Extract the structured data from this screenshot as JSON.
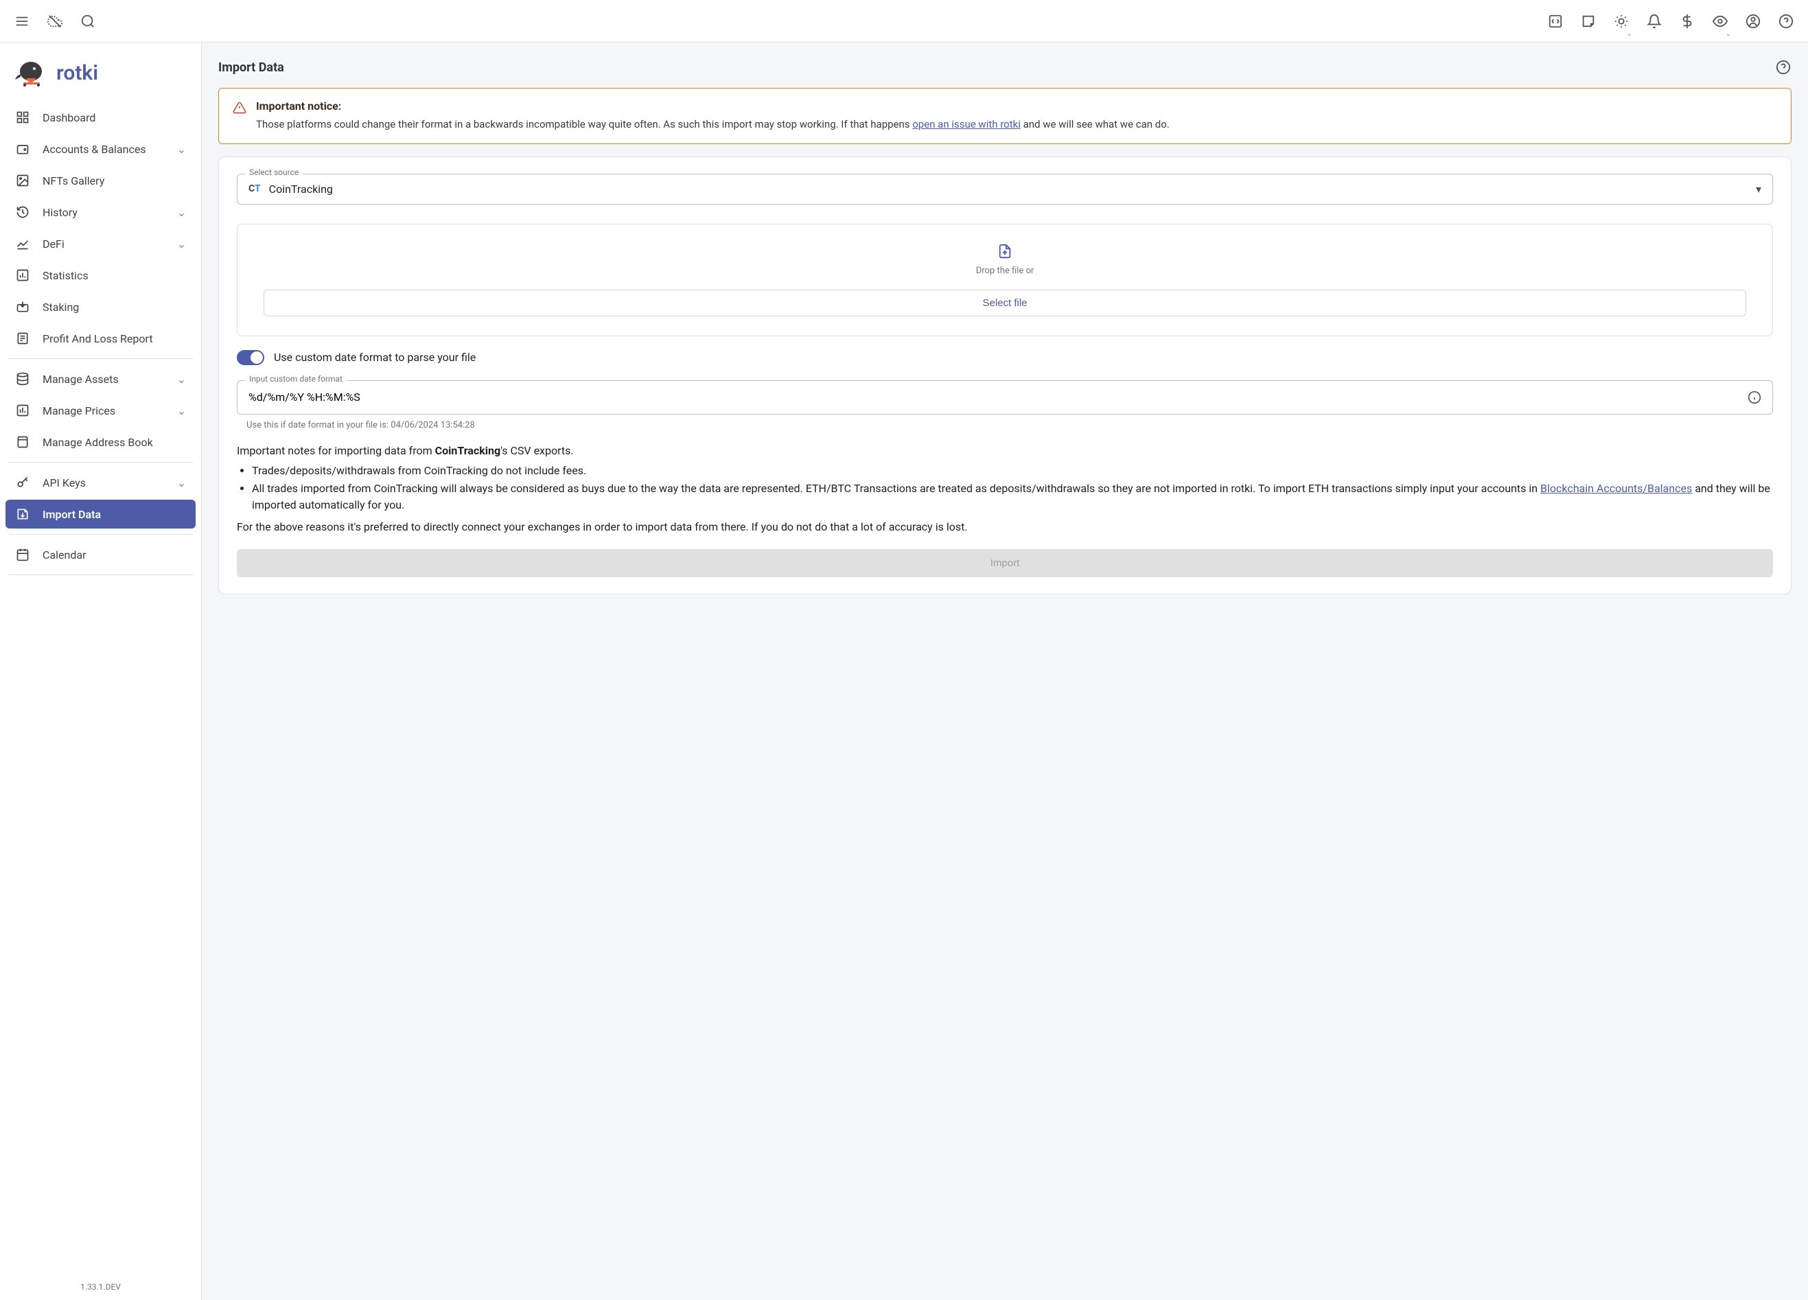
{
  "brand": {
    "name": "rotki"
  },
  "sidebar": {
    "items": [
      {
        "label": "Dashboard",
        "expandable": false
      },
      {
        "label": "Accounts & Balances",
        "expandable": true
      },
      {
        "label": "NFTs Gallery",
        "expandable": false
      },
      {
        "label": "History",
        "expandable": true
      },
      {
        "label": "DeFi",
        "expandable": true
      },
      {
        "label": "Statistics",
        "expandable": false
      },
      {
        "label": "Staking",
        "expandable": false
      },
      {
        "label": "Profit And Loss Report",
        "expandable": false
      },
      {
        "label": "Manage Assets",
        "expandable": true
      },
      {
        "label": "Manage Prices",
        "expandable": true
      },
      {
        "label": "Manage Address Book",
        "expandable": false
      },
      {
        "label": "API Keys",
        "expandable": true
      },
      {
        "label": "Import Data",
        "expandable": false
      },
      {
        "label": "Calendar",
        "expandable": false
      }
    ],
    "version": "1.33.1.DEV"
  },
  "page": {
    "title": "Import Data",
    "notice": {
      "title": "Important notice:",
      "body_prefix": "Those platforms could change their format in a backwards incompatible way quite often. As such this import may stop working. If that happens ",
      "link_text": "open an issue with rotki",
      "body_suffix": " and we will see what we can do."
    },
    "source": {
      "label": "Select source",
      "value": "CoinTracking"
    },
    "dropzone": {
      "text": "Drop the file or",
      "button": "Select file"
    },
    "toggle": {
      "label": "Use custom date format to parse your file",
      "on": true
    },
    "date_format": {
      "label": "Input custom date format",
      "value": "%d/%m/%Y %H:%M:%S",
      "hint": "Use this if date format in your file is: 04/06/2024 13:54:28"
    },
    "notes": {
      "intro_prefix": "Important notes for importing data from ",
      "intro_bold": "CoinTracking",
      "intro_suffix": "'s CSV exports.",
      "bullet1": "Trades/deposits/withdrawals from CoinTracking do not include fees.",
      "bullet2_prefix": "All trades imported from CoinTracking will always be considered as buys due to the way the data are represented. ETH/BTC Transactions are treated as deposits/withdrawals so they are not imported in rotki. To import ETH transactions simply input your accounts in ",
      "bullet2_link": "Blockchain Accounts/Balances",
      "bullet2_suffix": " and they will be imported automatically for you.",
      "footer": "For the above reasons it's preferred to directly connect your exchanges in order to import data from there. If you do not do that a lot of accuracy is lost."
    },
    "import_button": "Import"
  }
}
